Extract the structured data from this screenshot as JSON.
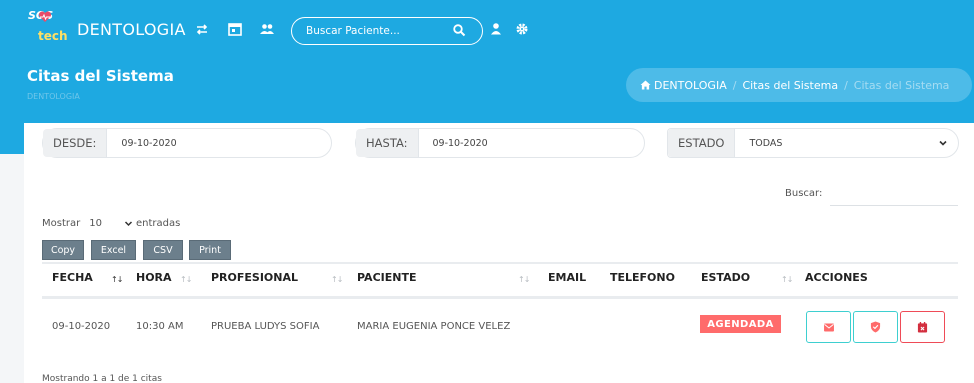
{
  "nav": {
    "logo_text": "SOS",
    "logo_tech": "tech",
    "brand": "DENTOLOGIA",
    "search_placeholder": "Buscar Paciente..."
  },
  "header": {
    "title": "Citas del Sistema",
    "subtitle": "DENTOLOGIA",
    "breadcrumb": [
      "DENTOLOGIA",
      "Citas del Sistema",
      "Citas del Sistema"
    ]
  },
  "filters": {
    "desde_label": "DESDE:",
    "desde_value": "09-10-2020",
    "hasta_label": "HASTA:",
    "hasta_value": "09-10-2020",
    "estado_label": "ESTADO",
    "estado_value": "TODAS"
  },
  "search": {
    "label": "Buscar:"
  },
  "length": {
    "prefix": "Mostrar",
    "value": "10",
    "suffix": "entradas"
  },
  "export_buttons": [
    "Copy",
    "Excel",
    "CSV",
    "Print"
  ],
  "table": {
    "headers": [
      "FECHA",
      "HORA",
      "PROFESIONAL",
      "PACIENTE",
      "EMAIL",
      "TELEFONO",
      "ESTADO",
      "ACCIONES"
    ],
    "rows": [
      {
        "fecha": "09-10-2020",
        "hora": "10:30 AM",
        "profesional": "PRUEBA LUDYS SOFIA",
        "paciente": "MARIA EUGENIA PONCE VELEZ",
        "email": "",
        "telefono": "",
        "estado": "AGENDADA"
      }
    ]
  },
  "footer": {
    "info": "Mostrando 1 a 1 de 1 citas"
  },
  "colors": {
    "primary": "#1ea9e1",
    "badge": "#ff6b6b",
    "action_teal": "#3ecfd0",
    "action_red": "#ef4b57",
    "export_btn": "#6c7f8c"
  }
}
